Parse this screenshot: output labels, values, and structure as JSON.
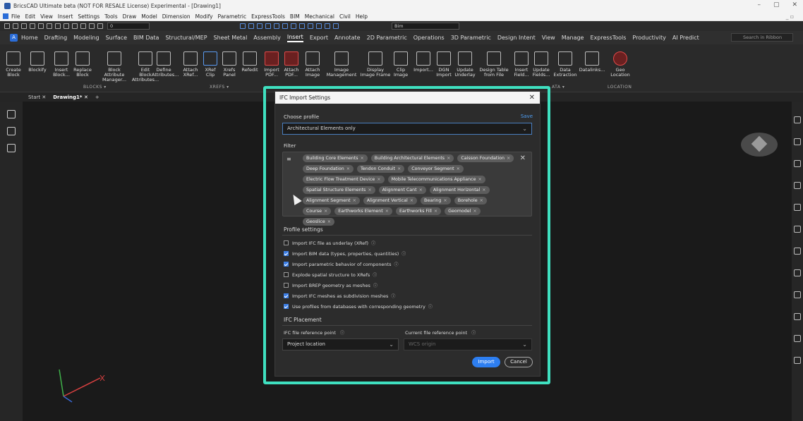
{
  "window": {
    "title": "BricsCAD Ultimate beta (NOT FOR RESALE License) Experimental - [Drawing1]"
  },
  "menu": [
    "File",
    "Edit",
    "View",
    "Insert",
    "Settings",
    "Tools",
    "Draw",
    "Model",
    "Dimension",
    "Modify",
    "Parametric",
    "ExpressTools",
    "BIM",
    "Mechanical",
    "Civil",
    "Help"
  ],
  "quick": {
    "layer": "0",
    "bim_select": "Bim"
  },
  "ribbon_tabs": [
    "Home",
    "Drafting",
    "Modeling",
    "Surface",
    "BIM Data",
    "Structural/MEP",
    "Sheet Metal",
    "Assembly",
    "Insert",
    "Export",
    "Annotate",
    "2D Parametric",
    "Operations",
    "3D Parametric",
    "Design Intent",
    "View",
    "Manage",
    "ExpressTools",
    "Productivity",
    "AI Predict"
  ],
  "ribbon_active": "Insert",
  "ribbon_search": "Search in Ribbon",
  "ribbon_buttons": [
    {
      "l1": "Create",
      "l2": "Block"
    },
    {
      "l1": "Blockify",
      "l2": ""
    },
    {
      "l1": "Insert",
      "l2": "Block..."
    },
    {
      "l1": "Replace",
      "l2": "Block"
    },
    {
      "l1": "Block Attribute",
      "l2": "Manager..."
    },
    {
      "l1": "Edit",
      "l2": "Block Attributes..."
    },
    {
      "l1": "Define",
      "l2": "Attributes..."
    },
    {
      "l1": "Attach",
      "l2": "XRef..."
    },
    {
      "l1": "XRef",
      "l2": "Clip"
    },
    {
      "l1": "Xrefs",
      "l2": "Panel"
    },
    {
      "l1": "Refedit",
      "l2": ""
    },
    {
      "l1": "Import",
      "l2": "PDF..."
    },
    {
      "l1": "Attach",
      "l2": "PDF..."
    },
    {
      "l1": "Attach",
      "l2": "Image"
    },
    {
      "l1": "Image",
      "l2": "Management"
    },
    {
      "l1": "Display",
      "l2": "Image Frame"
    },
    {
      "l1": "Clip",
      "l2": "Image"
    },
    {
      "l1": "Import...",
      "l2": ""
    },
    {
      "l1": "DGN",
      "l2": "Import"
    },
    {
      "l1": "Update",
      "l2": "Underlay"
    },
    {
      "l1": "Design Table",
      "l2": "from File"
    },
    {
      "l1": "Insert",
      "l2": "Field..."
    },
    {
      "l1": "Update",
      "l2": "Fields..."
    },
    {
      "l1": "Data",
      "l2": "Extraction"
    },
    {
      "l1": "Datalinks...",
      "l2": ""
    },
    {
      "l1": "Geo",
      "l2": "Location"
    }
  ],
  "ribbon_groups": {
    "blocks": "BLOCKS ▾",
    "xrefs": "XREFS ▾",
    "data": "ATA ▾",
    "location": "LOCATION"
  },
  "doc_tabs": [
    "Start",
    "Drawing1*"
  ],
  "dialog": {
    "title": "IFC Import Settings",
    "choose_profile": "Choose profile",
    "save": "Save",
    "profile_value": "Architectural Elements only",
    "filter_label": "Filter",
    "chips": [
      "Building Core Elements",
      "Building Architectural Elements",
      "Caisson Foundation",
      "Deep Foundation",
      "Tendon Conduit",
      "Conveyor Segment",
      "Electric Flow Treatment Device",
      "Mobile Telecommunications Appliance",
      "Spatial Structure Elements",
      "Alignment Cant",
      "Alignment Horizontal",
      "Alignment Segment",
      "Alignment Vertical",
      "Bearing",
      "Borehole",
      "Course",
      "Earthworks Element",
      "Earthworks Fill",
      "Geomodel",
      "Geoslice"
    ],
    "profile_settings": "Profile settings",
    "options": [
      {
        "label": "Import IFC file as underlay (XRef)",
        "checked": false
      },
      {
        "label": "Import BIM data (types, properties, quantities)",
        "checked": true
      },
      {
        "label": "Import parametric behavior of components",
        "checked": true
      },
      {
        "label": "Explode spatial structure to XRefs",
        "checked": false
      },
      {
        "label": "Import BREP geometry as meshes",
        "checked": false
      },
      {
        "label": "Import IFC meshes as subdivision meshes",
        "checked": true
      },
      {
        "label": "Use profiles from databases with corresponding geometry",
        "checked": true
      }
    ],
    "placement": "IFC Placement",
    "ifc_ref_label": "IFC file reference point",
    "ifc_ref_value": "Project location",
    "cur_ref_label": "Current file reference point",
    "cur_ref_value": "WCS origin",
    "import_btn": "Import",
    "cancel_btn": "Cancel"
  }
}
